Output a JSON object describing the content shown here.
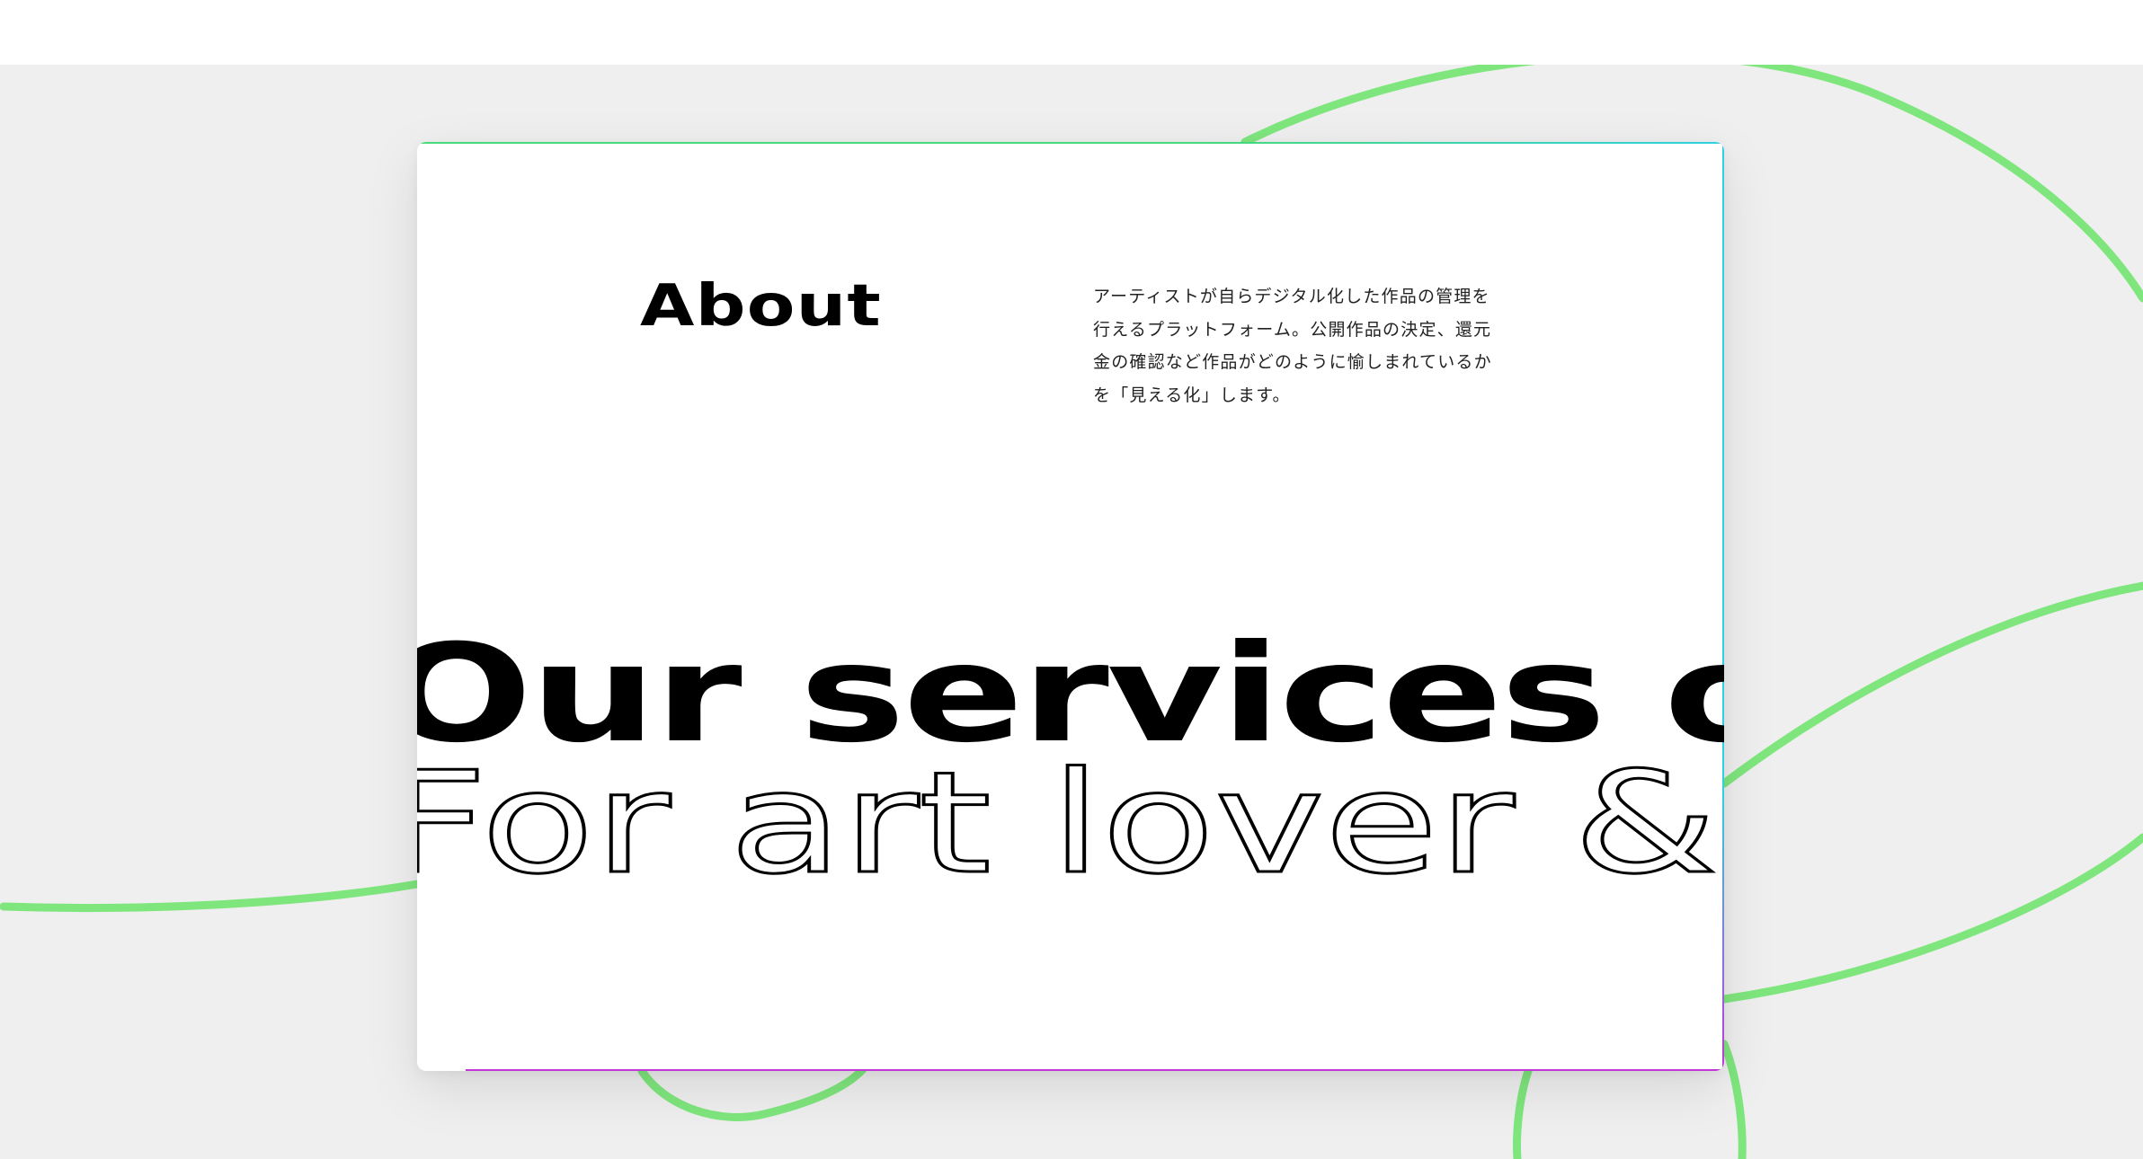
{
  "colors": {
    "background": "#efefef",
    "card": "#ffffff",
    "curve": "#7fe67d",
    "text": "#000000",
    "accent_edge_top": "#47d97a",
    "accent_edge_right": "#2fd0e0",
    "accent_edge_bottom": "#c236d8"
  },
  "about": {
    "title": "About",
    "description": "アーティストが自らデジタル化した作品の管理を行えるプラットフォーム。公開作品の決定、還元金の確認など作品がどのように愉しまれているかを「見える化」します。"
  },
  "marquee": {
    "line1": "Our services ou",
    "line2": "For art lover & a"
  }
}
